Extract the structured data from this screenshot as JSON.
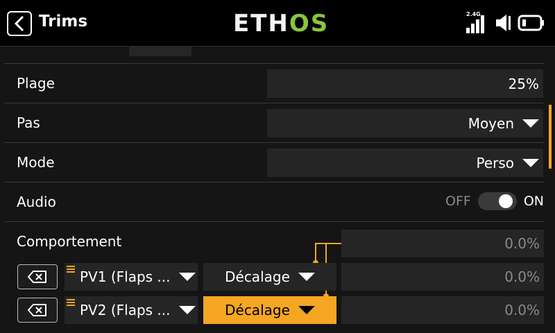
{
  "header": {
    "title": "Trims",
    "logo_main": "ETH",
    "logo_accent": "OS",
    "signal_label": "2.4G"
  },
  "colors": {
    "accent": "#f5a623",
    "logo_green": "#8ac53e",
    "field_bg": "#252525",
    "page_bg": "#151515"
  },
  "rows": {
    "range": {
      "label": "Plage",
      "value": "25%"
    },
    "step": {
      "label": "Pas",
      "value": "Moyen"
    },
    "mode": {
      "label": "Mode",
      "value": "Perso"
    },
    "audio": {
      "label": "Audio",
      "off_label": "OFF",
      "on_label": "ON",
      "enabled": true
    },
    "behavior": {
      "label": "Comportement",
      "value": "0.0%"
    }
  },
  "trim_sources": [
    {
      "source": "PV1 (Flaps ...",
      "mode": "Décalage",
      "value": "0.0%",
      "active": false
    },
    {
      "source": "PV2 (Flaps ...",
      "mode": "Décalage",
      "value": "0.0%",
      "active": true
    }
  ],
  "icons": {
    "back": "chevron-left-icon",
    "signal": "signal-icon",
    "volume": "speaker-icon",
    "battery": "battery-icon",
    "delete": "backspace-icon",
    "drag": "drag-handle-icon"
  }
}
